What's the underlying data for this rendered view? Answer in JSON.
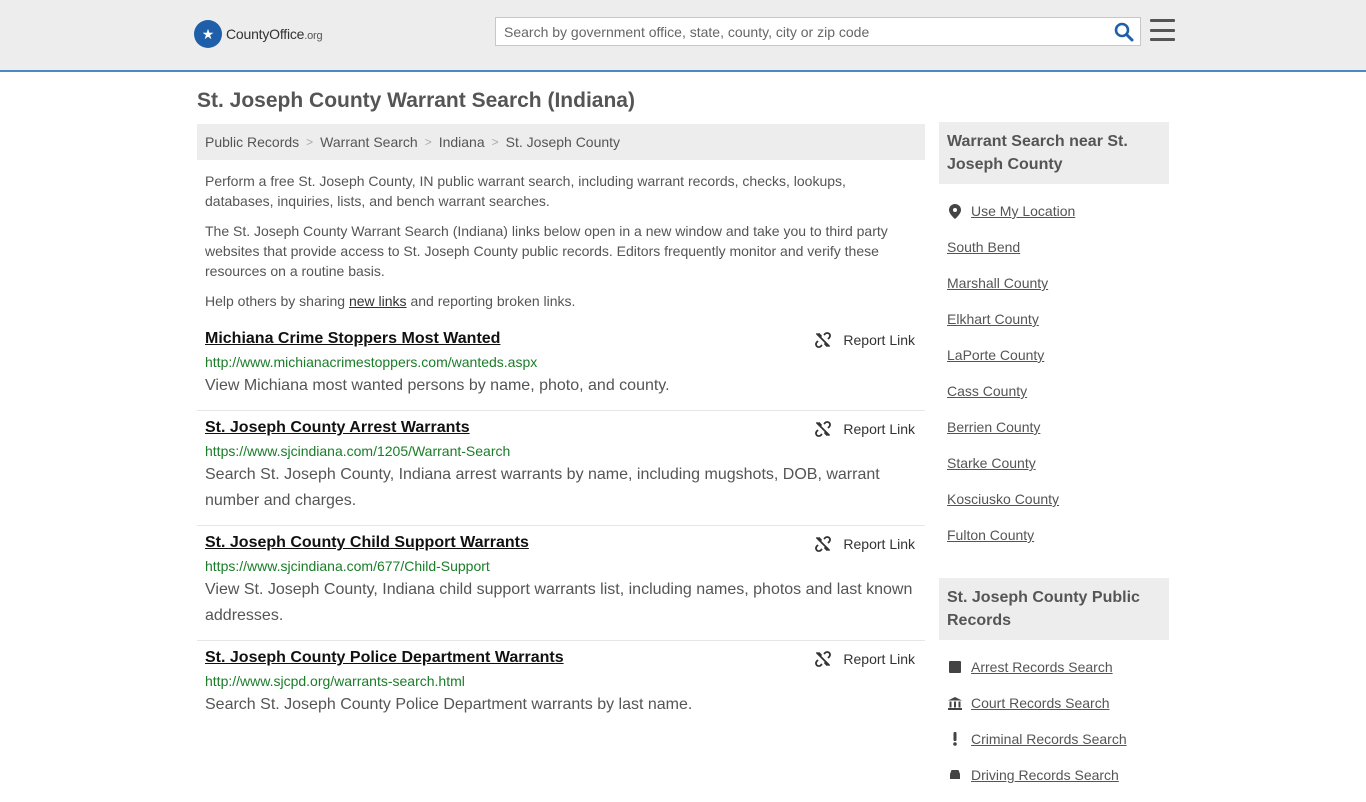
{
  "header": {
    "logo_main": "CountyOffice",
    "logo_org": ".org",
    "search_placeholder": "Search by government office, state, county, city or zip code"
  },
  "page_title": "St. Joseph County Warrant Search (Indiana)",
  "breadcrumb": [
    "Public Records",
    "Warrant Search",
    "Indiana",
    "St. Joseph County"
  ],
  "intro": {
    "p1": "Perform a free St. Joseph County, IN public warrant search, including warrant records, checks, lookups, databases, inquiries, lists, and bench warrant searches.",
    "p2": "The St. Joseph County Warrant Search (Indiana) links below open in a new window and take you to third party websites that provide access to St. Joseph County public records. Editors frequently monitor and verify these resources on a routine basis.",
    "p3_before": "Help others by sharing ",
    "p3_link": "new links",
    "p3_after": " and reporting broken links."
  },
  "report_label": "Report Link",
  "links": [
    {
      "title": "Michiana Crime Stoppers Most Wanted",
      "url": "http://www.michianacrimestoppers.com/wanteds.aspx",
      "desc": "View Michiana most wanted persons by name, photo, and county."
    },
    {
      "title": "St. Joseph County Arrest Warrants",
      "url": "https://www.sjcindiana.com/1205/Warrant-Search",
      "desc": "Search St. Joseph County, Indiana arrest warrants by name, including mugshots, DOB, warrant number and charges."
    },
    {
      "title": "St. Joseph County Child Support Warrants",
      "url": "https://www.sjcindiana.com/677/Child-Support",
      "desc": "View St. Joseph County, Indiana child support warrants list, including names, photos and last known addresses."
    },
    {
      "title": "St. Joseph County Police Department Warrants",
      "url": "http://www.sjcpd.org/warrants-search.html",
      "desc": "Search St. Joseph County Police Department warrants by last name."
    }
  ],
  "sidebar": {
    "nearby_heading": "Warrant Search near St. Joseph County",
    "use_location": "Use My Location",
    "nearby": [
      "South Bend",
      "Marshall County",
      "Elkhart County",
      "LaPorte County",
      "Cass County",
      "Berrien County",
      "Starke County",
      "Kosciusko County",
      "Fulton County"
    ],
    "records_heading": "St. Joseph County Public Records",
    "records": [
      {
        "label": "Arrest Records Search",
        "icon": "square-icon"
      },
      {
        "label": "Court Records Search",
        "icon": "courthouse-icon"
      },
      {
        "label": "Criminal Records Search",
        "icon": "exclamation-icon"
      },
      {
        "label": "Driving Records Search",
        "icon": "car-icon"
      }
    ]
  }
}
